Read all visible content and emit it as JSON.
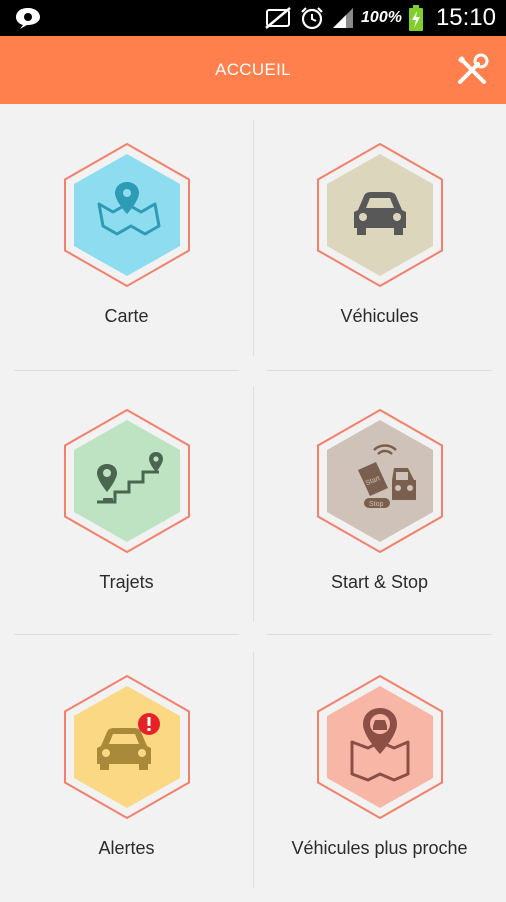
{
  "status_bar": {
    "battery": "100%",
    "time": "15:10",
    "icons": [
      "chat-bubble-icon",
      "no-sim-icon",
      "alarm-icon",
      "signal-icon",
      "battery-charging-icon"
    ]
  },
  "app_bar": {
    "title": "ACCUEIL",
    "action_icon": "tools-icon",
    "color": "#ff7f4d"
  },
  "menu": [
    {
      "label": "Carte",
      "icon": "map-pin-icon",
      "fill": "#8edcf0"
    },
    {
      "label": "Véhicules",
      "icon": "car-icon",
      "fill": "#dcd7bc"
    },
    {
      "label": "Trajets",
      "icon": "route-icon",
      "fill": "#bde3c2"
    },
    {
      "label": "Start & Stop",
      "icon": "key-car-icon",
      "fill": "#cfc2b8"
    },
    {
      "label": "Alertes",
      "icon": "car-alert-icon",
      "fill": "#fbd883"
    },
    {
      "label": "Véhicules plus proche",
      "icon": "nearby-car-map-icon",
      "fill": "#f8b6a6"
    }
  ],
  "colors": {
    "hex_outline": "#f3806a",
    "background": "#f2f2f2"
  }
}
